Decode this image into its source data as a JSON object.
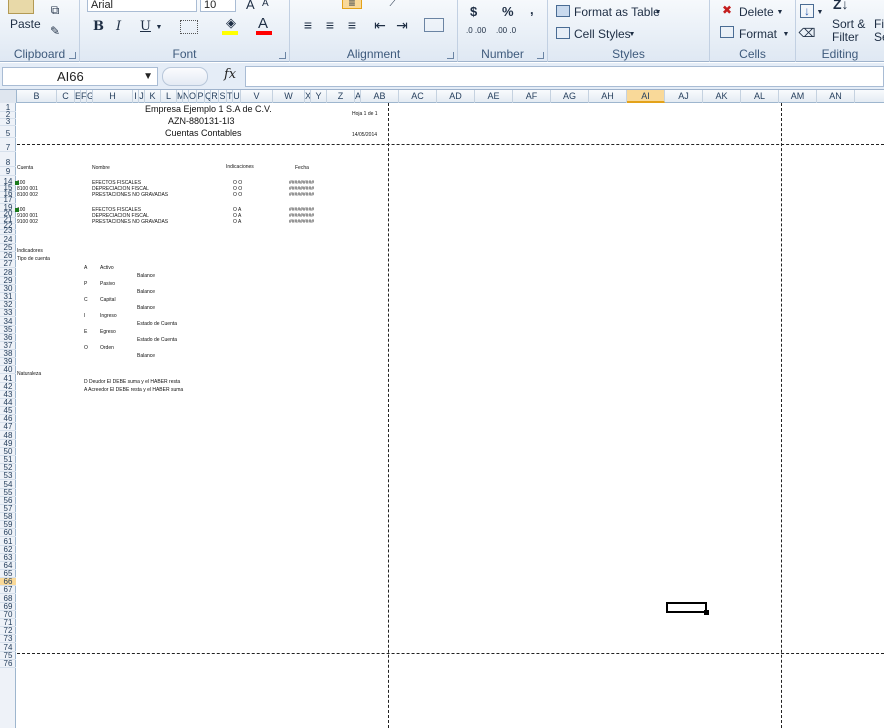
{
  "ribbon": {
    "clipboard": {
      "paste": "Paste",
      "label": "Clipboard"
    },
    "font": {
      "name": "Arial",
      "size": "10",
      "label": "Font",
      "bold": "B",
      "italic": "I",
      "underline": "U",
      "grow": "A",
      "shrink": "A",
      "fill_color": "#ffff00",
      "font_color": "#ff0000"
    },
    "alignment": {
      "label": "Alignment"
    },
    "number": {
      "currency": "$",
      "percent": "%",
      "comma": ",",
      "inc": ".0 .00",
      "dec": ".00 .0",
      "label": "Number"
    },
    "styles": {
      "format_table": "Format as Table",
      "cell_styles": "Cell Styles",
      "label": "Styles"
    },
    "cells": {
      "delete": "Delete",
      "format": "Format",
      "label": "Cells"
    },
    "editing": {
      "sort_filter": "Sort &",
      "filter": "Filter",
      "find": "Fi",
      "select": "Se",
      "label": "Editing"
    }
  },
  "formula_bar": {
    "name_box": "AI66",
    "fx": "fx",
    "formula": ""
  },
  "columns": [
    "B",
    "C",
    "E",
    "F",
    "G",
    "H",
    "I",
    "J",
    "K",
    "L",
    "M",
    "N",
    "O",
    "P",
    "Q",
    "R",
    "S",
    "T",
    "U",
    "V",
    "W",
    "X",
    "Y",
    "Z",
    "A",
    "AB",
    "AC",
    "AD",
    "AE",
    "AF",
    "AG",
    "AH",
    "AI",
    "AJ",
    "AK",
    "AL",
    "AM",
    "AN"
  ],
  "selected_column": "AI",
  "selected_row": "66",
  "rows": [
    "1",
    "2",
    "3",
    "5",
    "7",
    "8",
    "9",
    "14",
    "15",
    "16",
    "17",
    "19",
    "20",
    "21",
    "22",
    "23",
    "24",
    "25",
    "26",
    "27",
    "28",
    "29",
    "30",
    "31",
    "32",
    "33",
    "34",
    "35",
    "36",
    "37",
    "38",
    "39",
    "40",
    "41",
    "42",
    "43",
    "44",
    "45",
    "46",
    "47",
    "48",
    "49",
    "50",
    "51",
    "52",
    "53",
    "54",
    "55",
    "56",
    "57",
    "58",
    "59",
    "60",
    "61",
    "62",
    "63",
    "64",
    "65",
    "66",
    "67",
    "68",
    "69",
    "70",
    "71",
    "72",
    "73",
    "74",
    "75",
    "76"
  ],
  "report": {
    "company": "Empresa Ejemplo 1 S.A de C.V.",
    "rfc": "AZN-880131-1I3",
    "subtitle": "Cuentas Contables",
    "page": "Hoja 1 de 1",
    "date": "14/05/2014",
    "headers": {
      "cuenta": "Cuenta",
      "nombre": "Nombre",
      "indicaciones": "Indicaciones",
      "fecha": "Fecha"
    },
    "group1": [
      {
        "cuenta": "100",
        "nombre": "EFECTOS FISCALES",
        "ind": "O  O",
        "fecha": "#########"
      },
      {
        "cuenta": "8100 001",
        "nombre": "DEPRECIACION FISCAL",
        "ind": "O  O",
        "fecha": "#########"
      },
      {
        "cuenta": "8100 002",
        "nombre": "PRESTACIONES NO GRAVADAS",
        "ind": "O  O",
        "fecha": "#########"
      }
    ],
    "group2": [
      {
        "cuenta": "100",
        "nombre": "EFECTOS FISCALES",
        "ind": "O  A",
        "fecha": "#########"
      },
      {
        "cuenta": "9100 001",
        "nombre": "DEPRECIACION FISCAL",
        "ind": "O  A",
        "fecha": "#########"
      },
      {
        "cuenta": "9100 002",
        "nombre": "PRESTACIONES NO GRAVADAS",
        "ind": "O  A",
        "fecha": "#########"
      }
    ],
    "indicadores": "Indicadores",
    "tipo_cuenta": "Tipo de cuenta",
    "tipos": [
      {
        "code": "A",
        "name": "Activo",
        "estado": "Balance"
      },
      {
        "code": "P",
        "name": "Pasivo",
        "estado": "Balance"
      },
      {
        "code": "C",
        "name": "Capital",
        "estado": "Balance"
      },
      {
        "code": "I",
        "name": "Ingreso",
        "estado": "Estado de Cuenta"
      },
      {
        "code": "E",
        "name": "Egreso",
        "estado": "Estado de Cuenta"
      },
      {
        "code": "O",
        "name": "Orden",
        "estado": "Balance"
      }
    ],
    "naturaleza": "Naturaleza",
    "nat_deudor": "D Deudor  El DEBE suma y el HABER resta",
    "nat_acreedor": "A Acreedor El DEBE resta y el HABER suma"
  }
}
